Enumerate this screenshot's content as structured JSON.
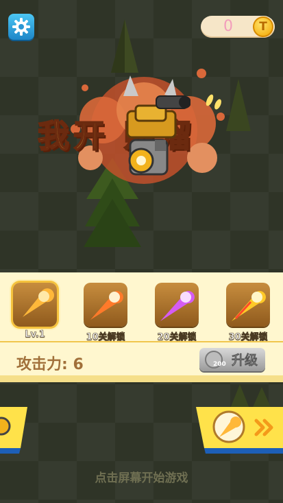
{
  "top_bar": {
    "settings_icon": "gear-icon",
    "coin_count": "0",
    "coin_symbol": "T"
  },
  "title": {
    "text": "我开坦克贼溜",
    "visible_text": "我开    贼溜"
  },
  "weapons": {
    "slots": [
      {
        "label": "Lv.1",
        "selected": true,
        "color": "#ffb83a"
      },
      {
        "label": "10关解锁",
        "selected": false,
        "color": "#ff9b3a"
      },
      {
        "label": "20关解锁",
        "selected": false,
        "color": "#e06bff"
      },
      {
        "label": "30关解锁",
        "selected": false,
        "color": "#ffd23a"
      }
    ]
  },
  "stats": {
    "attack_label": "攻击力: 6",
    "upgrade_label": "升级",
    "upgrade_cost": "200",
    "upgrade_coin_symbol": "T"
  },
  "footer": {
    "start_hint": "点击屏幕开始游戏"
  },
  "colors": {
    "panel_bg": "#fff7cf",
    "accent_yellow": "#f5c23d",
    "button_blue": "#1d5fb8"
  }
}
